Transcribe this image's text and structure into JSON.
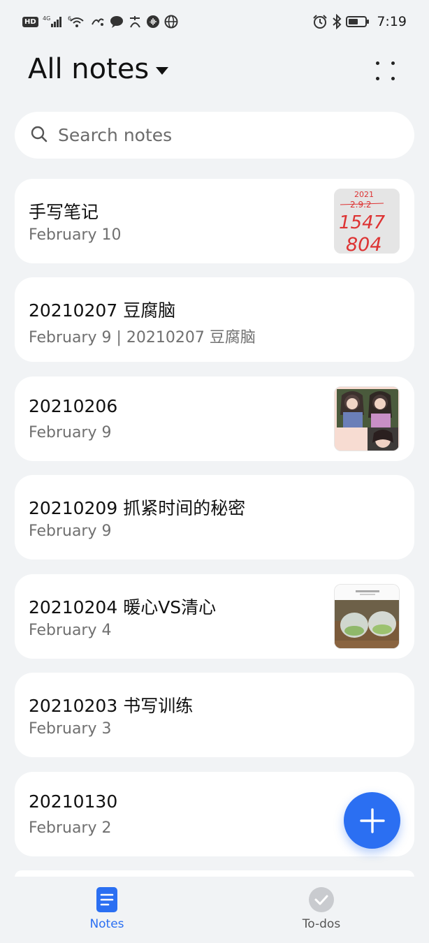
{
  "status_bar": {
    "hd": "HD",
    "network": "4G",
    "wifi_badge": "6",
    "time": "7:19",
    "icons": [
      "hd-badge",
      "signal-icon",
      "wifi-icon",
      "app-icon",
      "chat-icon",
      "alipay-icon",
      "voice-icon",
      "globe-icon",
      "alarm-icon",
      "bluetooth-icon",
      "battery-icon"
    ]
  },
  "header": {
    "title": "All notes",
    "dropdown_icon": "caret-down-icon",
    "more_icon": "more-dots-icon"
  },
  "search": {
    "placeholder": "Search notes",
    "icon": "search-icon"
  },
  "notes": [
    {
      "title": "手写笔记",
      "subtitle": "February 10",
      "thumbnail": "handwriting"
    },
    {
      "title": "20210207 豆腐脑",
      "subtitle": "February 9 | 20210207 豆腐脑",
      "thumbnail": null
    },
    {
      "title": "20210206",
      "subtitle": "February 9",
      "thumbnail": "dolls"
    },
    {
      "title": "20210209 抓紧时间的秘密",
      "subtitle": "February 9",
      "thumbnail": null
    },
    {
      "title": "20210204 暖心VS清心",
      "subtitle": "February 4",
      "thumbnail": "tea"
    },
    {
      "title": "20210203 书写训练",
      "subtitle": "February 3",
      "thumbnail": null
    },
    {
      "title": "20210130",
      "subtitle": "February 2",
      "thumbnail": null
    }
  ],
  "thumbnail_text": {
    "handwriting_line1": "2021",
    "handwriting_line2": "2.9.2",
    "handwriting_line3": "1547",
    "handwriting_line4": "804"
  },
  "fab": {
    "icon": "plus-icon"
  },
  "bottom_nav": {
    "items": [
      {
        "label": "Notes",
        "icon": "note-icon",
        "active": true
      },
      {
        "label": "To-dos",
        "icon": "checkmark-icon",
        "active": false
      }
    ]
  },
  "colors": {
    "accent": "#2b6ff2",
    "background": "#f1f3f5",
    "card": "#ffffff",
    "secondary_text": "#707070"
  }
}
